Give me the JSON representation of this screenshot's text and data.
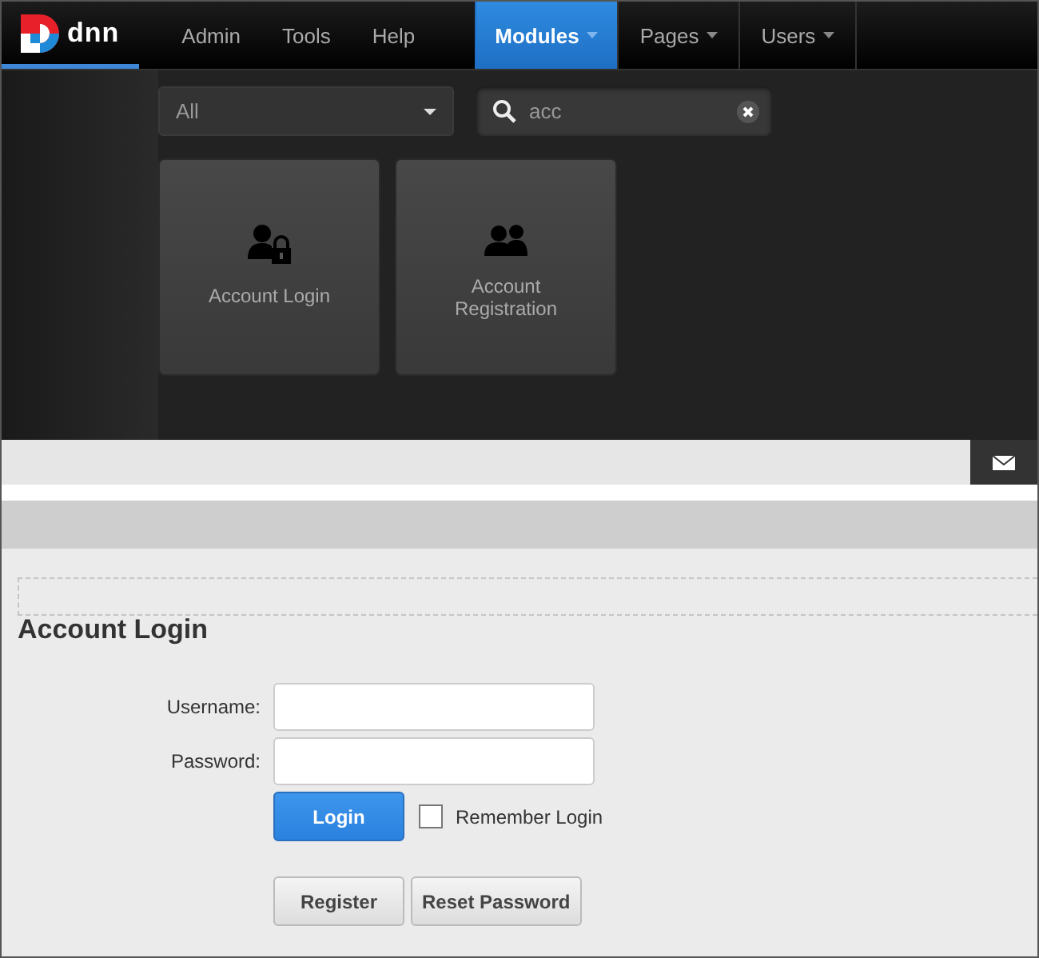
{
  "logo": {
    "text": "dnn"
  },
  "menu": [
    {
      "label": "Admin",
      "selected": false
    },
    {
      "label": "Tools",
      "selected": false
    },
    {
      "label": "Help",
      "selected": false
    }
  ],
  "tabs": [
    {
      "label": "Modules",
      "dropdown": true,
      "selected": true
    },
    {
      "label": "Pages",
      "dropdown": true,
      "selected": false
    },
    {
      "label": "Users",
      "dropdown": true,
      "selected": false
    }
  ],
  "filter": {
    "value": "All"
  },
  "search": {
    "value": "acc"
  },
  "modules": [
    {
      "label": "Account Login",
      "kind": "user-lock"
    },
    {
      "label": "Account Registration",
      "kind": "users"
    }
  ],
  "login": {
    "title": "Account Login",
    "fields": [
      {
        "label": "Username:"
      },
      {
        "label": "Password:"
      }
    ],
    "login_button": "Login",
    "remember": {
      "label": "Remember Login",
      "checked": false
    },
    "buttons": [
      "Register",
      "Reset Password"
    ]
  }
}
